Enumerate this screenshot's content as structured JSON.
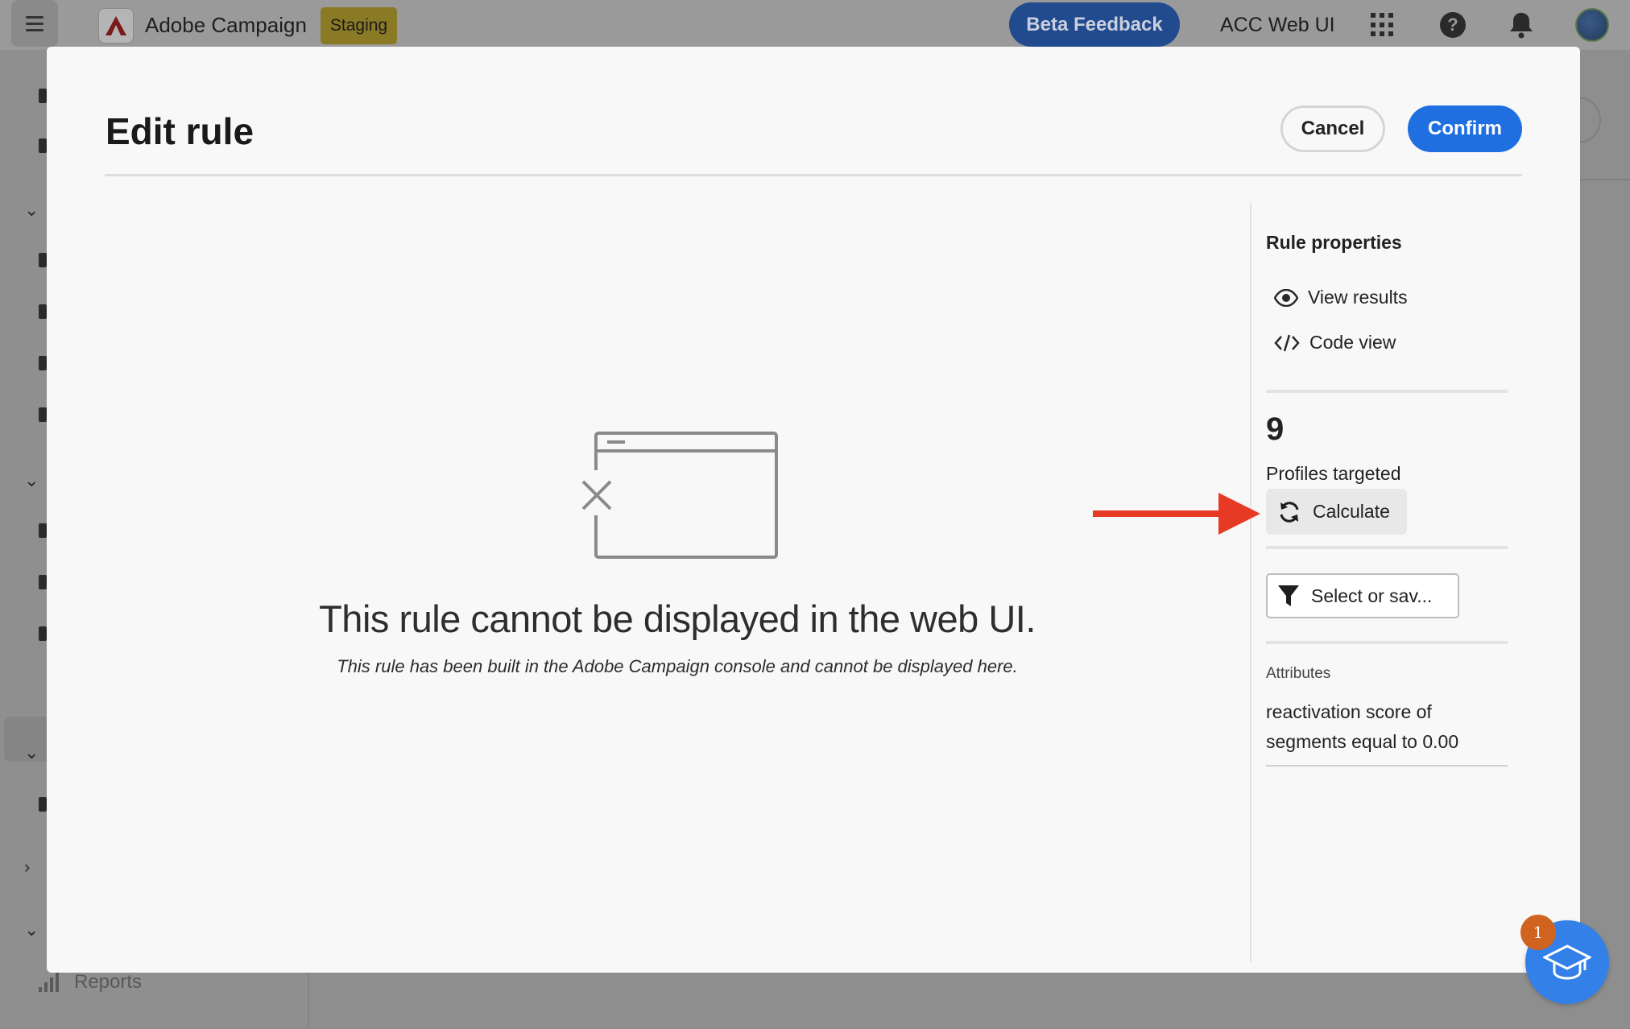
{
  "topbar": {
    "brand_name": "Adobe Campaign",
    "environment_badge": "Staging",
    "beta_feedback_label": "Beta Feedback",
    "org_label": "ACC Web UI"
  },
  "sidebar": {
    "reports_label": "Reports"
  },
  "modal": {
    "title": "Edit rule",
    "cancel_label": "Cancel",
    "confirm_label": "Confirm",
    "empty_state": {
      "title": "This rule cannot be displayed in the web UI.",
      "subtitle": "This rule has been built in the Adobe Campaign console and cannot be displayed here."
    },
    "rule_properties": {
      "title": "Rule properties",
      "view_results_label": "View results",
      "code_view_label": "Code view",
      "profiles_count": "9",
      "profiles_label": "Profiles targeted",
      "calculate_label": "Calculate",
      "filter_label": "Select or sav...",
      "attributes_label": "Attributes",
      "attributes_value": "reactivation score of segments equal to 0.00"
    }
  },
  "learn": {
    "badge_count": "1"
  },
  "colors": {
    "accent": "#1f6fe0",
    "beta_button": "#214a8f",
    "staging_badge": "#8a7a26",
    "annotation_arrow": "#e63a24",
    "learn_button": "#3380e8",
    "learn_badge": "#d0631f"
  },
  "icons": {
    "menu": "hamburger-icon",
    "brand": "adobe-logo-icon",
    "apps": "apps-grid-icon",
    "help": "help-icon",
    "notifications": "bell-icon",
    "view_results": "eye-icon",
    "code_view": "code-icon",
    "calculate": "refresh-icon",
    "filter": "filter-icon",
    "learn": "graduation-cap-icon"
  }
}
